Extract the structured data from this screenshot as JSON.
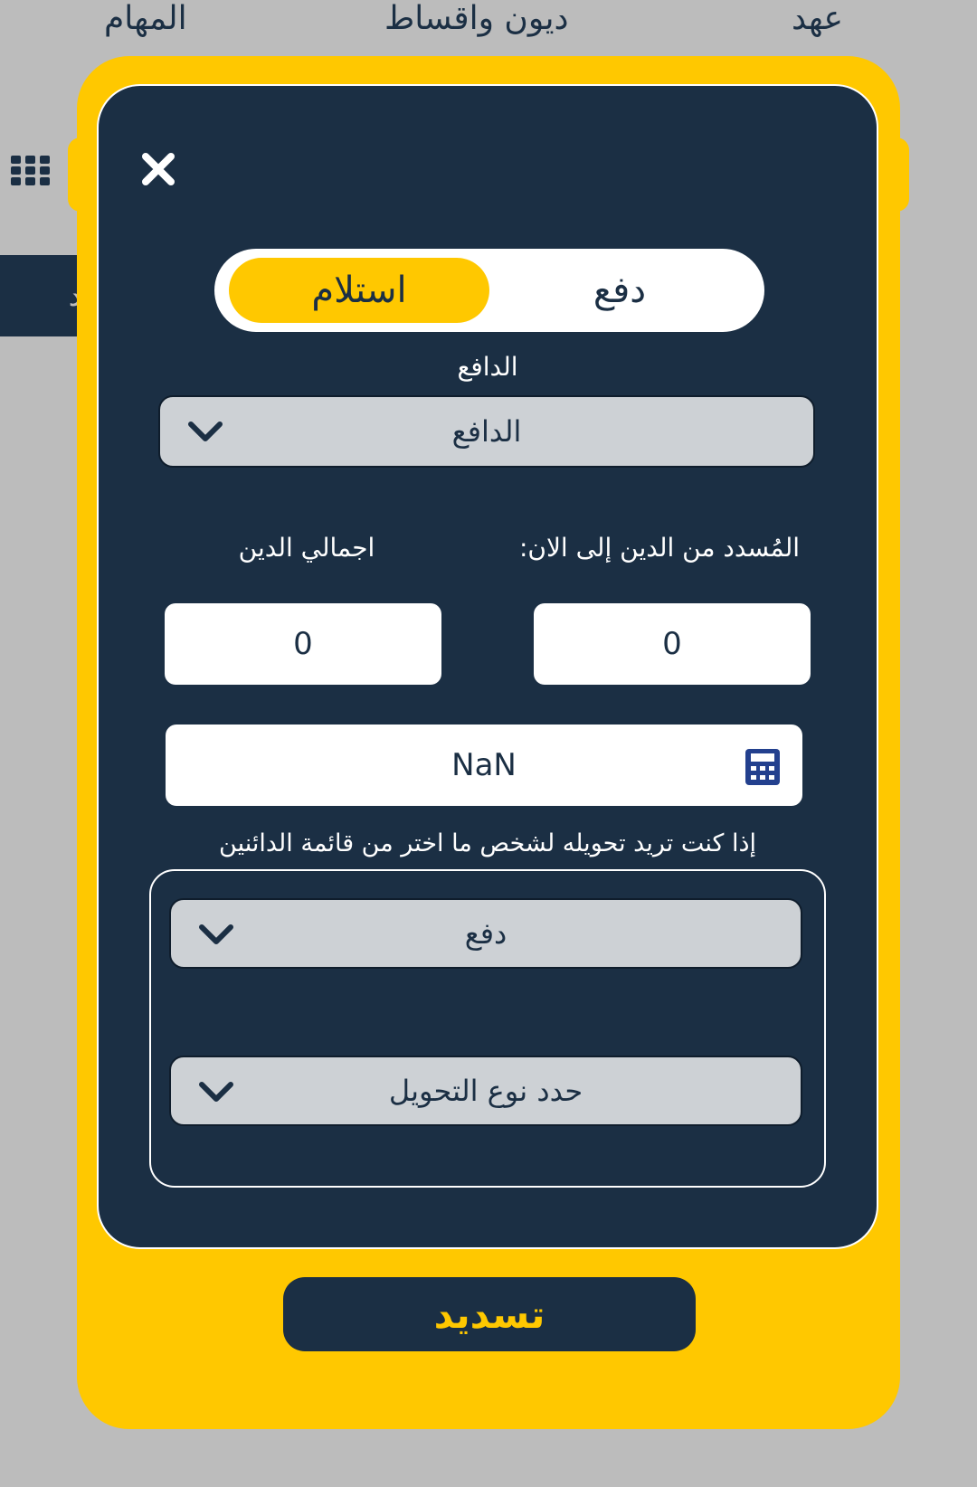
{
  "background": {
    "tabs": [
      "المهام",
      "ديون واقساط",
      "عهد"
    ],
    "strip_text": "د"
  },
  "modal": {
    "toggle": {
      "receive_label": "استلام",
      "pay_label": "دفع",
      "selected": "استلام"
    },
    "payer": {
      "label": "الدافع",
      "selected": "الدافع"
    },
    "paid_so_far": {
      "label": "المُسدد من الدين إلى الان:",
      "value": "0"
    },
    "total_debt": {
      "label": "اجمالي الدين",
      "value": "0"
    },
    "calculator_value": "NaN",
    "transfer_hint": "إذا كنت تريد تحويله لشخص ما اختر من قائمة الدائنين",
    "transfer_person": {
      "selected": "دفع"
    },
    "transfer_type": {
      "selected": "حدد نوع التحويل"
    },
    "submit_label": "تسديد"
  },
  "colors": {
    "accent": "#ffc800",
    "dark": "#1b2f44",
    "field": "#cdd1d5"
  },
  "icons": [
    "close-icon",
    "grid-menu-icon",
    "chevron-down-icon",
    "calculator-icon"
  ]
}
